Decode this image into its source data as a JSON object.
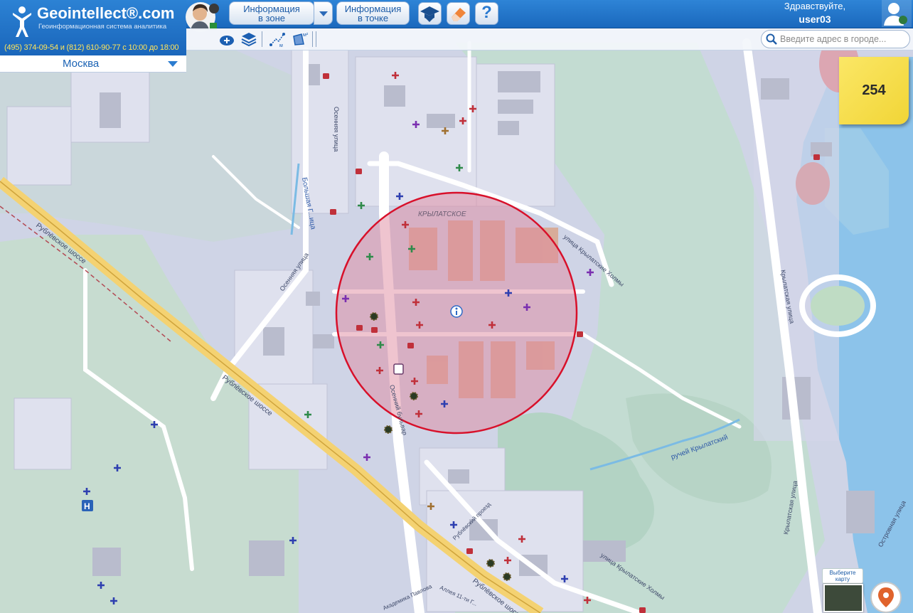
{
  "app": {
    "logo_text": "Geointellect®.com",
    "logo_subtitle": "Геоинформационная система аналитика",
    "phone_line": "(495) 374-09-54 и (812) 610-90-77 с 10:00 до 18:00"
  },
  "city": {
    "selected": "Москва"
  },
  "toolbar": {
    "btn_zone_line1": "Информация",
    "btn_zone_line2": "в зоне",
    "btn_point_line1": "Информация",
    "btn_point_line2": "в точке",
    "help_label": "?"
  },
  "user": {
    "greeting": "Здравствуйте,",
    "name": "user03"
  },
  "search": {
    "placeholder": "Введите адрес в городе..."
  },
  "counter": {
    "value": "254"
  },
  "map_chooser": {
    "label": "Выберите карту"
  },
  "map": {
    "labels": {
      "district": "КРЫЛАТСКОЕ",
      "rublevskoe_1": "Рублёвское шоссе",
      "rublevskoe_2": "Рублёвское шоссе",
      "rublevskoe_3": "Рублёвское шоссе",
      "osennyaya_1": "Осенняя улица",
      "osennyaya_2": "Осенняя улица",
      "osenny_bulvar": "Осенний бульвар",
      "bolshaya": "Большая Г...ица",
      "krylatskie_holmy_1": "улица Крылатские Холмы",
      "krylatskie_holmy_2": "улица Крылатские Холмы",
      "krylatskaya_1": "Крылатская улица",
      "krylatskaya_2": "Крылатская улица",
      "ruchey": "ручей Крылатский",
      "rublevsky_proezd": "Рублёвский проезд",
      "pavlova": "Академика Павлова",
      "alleya": "Аллея 11-ти Г...",
      "ostrovnaya": "Островная улица",
      "hospital_letter": "H"
    },
    "colors": {
      "zone_fill": "#e08aa0",
      "zone_stroke": "#d8102a",
      "pharmacy_red": "#c0303a",
      "pharmacy_green": "#2f8a4a",
      "pharmacy_blue": "#2e3fb0",
      "pharmacy_purple": "#7a2fb0",
      "pharmacy_brown": "#a07030"
    }
  }
}
